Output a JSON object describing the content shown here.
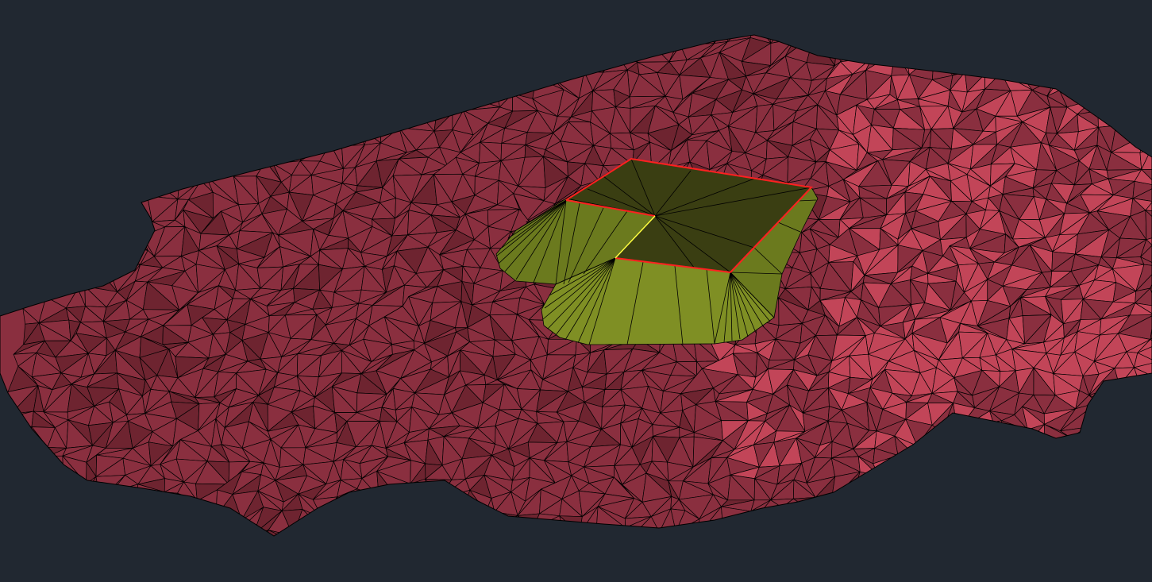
{
  "viewport": {
    "background_color": "#212831",
    "view_style": "shaded-3d-with-edges"
  },
  "terrain_surface": {
    "type": "triangulated-surface",
    "fill_color": "#8a2f3f",
    "light_fill_color": "#c24558",
    "dark_fill_color": "#6e2430",
    "edge_color": "#000000"
  },
  "pad_surface": {
    "type": "grading-pad",
    "top_color": "#3a3e12",
    "slope_color": "#6b7a1e",
    "slope_light_color": "#7f8f24",
    "edge_color": "#000000",
    "boundary_color": "#ff2020",
    "feature_line_color": "#ffff40"
  }
}
